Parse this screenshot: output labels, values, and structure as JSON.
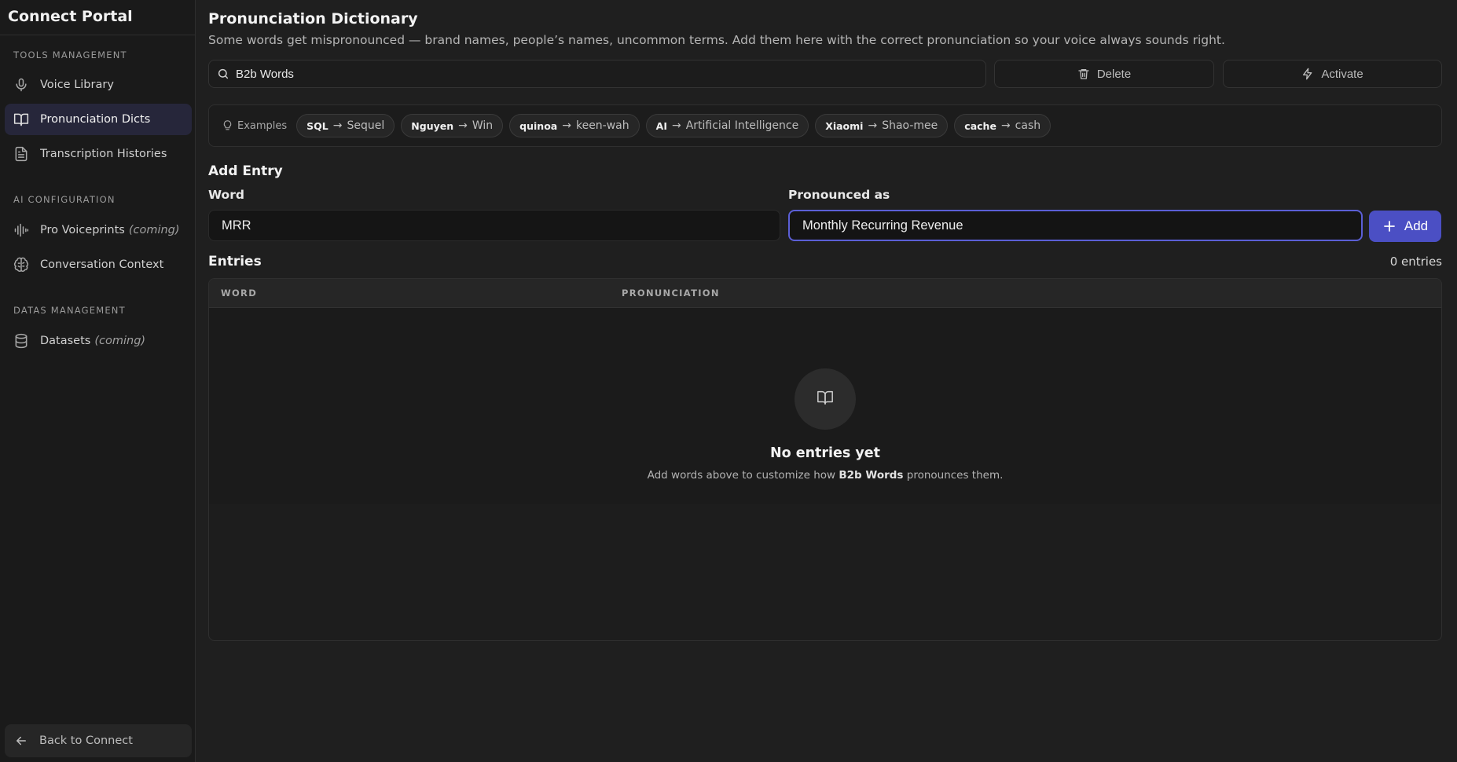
{
  "sidebar": {
    "brand": "Connect Portal",
    "sections": [
      {
        "label": "TOOLS MANAGEMENT"
      },
      {
        "label": "AI CONFIGURATION"
      },
      {
        "label": "DATAS MANAGEMENT"
      }
    ],
    "items": [
      {
        "label": "Voice Library",
        "icon": "microphone-icon",
        "coming": ""
      },
      {
        "label": "Pronunciation Dicts",
        "icon": "book-icon",
        "coming": "",
        "active": true
      },
      {
        "label": "Transcription Histories",
        "icon": "document-icon",
        "coming": ""
      },
      {
        "label": "Pro Voiceprints",
        "icon": "waveform-icon",
        "coming": "(coming)"
      },
      {
        "label": "Conversation Context",
        "icon": "brain-icon",
        "coming": ""
      },
      {
        "label": "Datasets",
        "icon": "database-icon",
        "coming": "(coming)"
      }
    ],
    "back_label": "Back to Connect"
  },
  "header": {
    "title": "Pronunciation Dictionary",
    "description": "Some words get mispronounced — brand names, people’s names, uncommon terms. Add them here with the correct pronunciation so your voice always sounds right."
  },
  "toolbar": {
    "search_value": "B2b Words",
    "delete_label": "Delete",
    "activate_label": "Activate"
  },
  "examples": {
    "label": "Examples",
    "arrow": "→",
    "items": [
      {
        "word": "SQL",
        "pron": "Sequel"
      },
      {
        "word": "Nguyen",
        "pron": "Win"
      },
      {
        "word": "quinoa",
        "pron": "keen-wah"
      },
      {
        "word": "AI",
        "pron": "Artificial Intelligence"
      },
      {
        "word": "Xiaomi",
        "pron": "Shao-mee"
      },
      {
        "word": "cache",
        "pron": "cash"
      }
    ]
  },
  "add_entry": {
    "title": "Add Entry",
    "word_label": "Word",
    "word_value": "MRR",
    "pron_label": "Pronounced as",
    "pron_value": "Monthly Recurring Revenue",
    "add_label": "Add"
  },
  "entries": {
    "title": "Entries",
    "count": "0 entries",
    "columns": [
      "WORD",
      "PRONUNCIATION"
    ],
    "empty_title": "No entries yet",
    "empty_desc_pre": "Add words above to customize how ",
    "empty_desc_bold": "B2b Words",
    "empty_desc_post": " pronounces them."
  },
  "colors": {
    "accent": "#4b4fc4",
    "focus_border": "#5b5fd6",
    "background": "#1f1f1f",
    "sidebar": "#1a1a1a"
  }
}
